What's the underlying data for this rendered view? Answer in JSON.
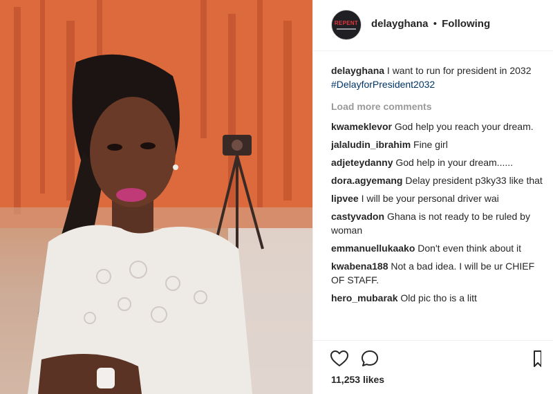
{
  "post": {
    "username": "delayghana",
    "separator": "•",
    "follow_status": "Following",
    "avatar_text": "REPENT",
    "caption": {
      "username": "delayghana",
      "text_before": "I want to run for president in 2032",
      "hashtag": "#DelayforPresident2032"
    },
    "load_more_label": "Load more comments",
    "comments": [
      {
        "user": "kwameklevor",
        "text": "God help you reach your dream."
      },
      {
        "user": "jalaludin_ibrahim",
        "text": "Fine girl"
      },
      {
        "user": "adjeteydanny",
        "text": "God help in your dream......"
      },
      {
        "user": "dora.agyemang",
        "text": "Delay president p3ky33 like that"
      },
      {
        "user": "lipvee",
        "text": "I will be your personal driver wai"
      },
      {
        "user": "castyvadon",
        "text": "Ghana is not ready to be ruled by woman"
      },
      {
        "user": "emmanuellukaako",
        "text": "Don't even think about it"
      },
      {
        "user": "kwabena188",
        "text": "Not a bad idea. I will be ur CHIEF OF STAFF."
      },
      {
        "user": "hero_mubarak",
        "text": "Old pic tho is a litt"
      }
    ],
    "likes": "11,253 likes"
  },
  "icons": {
    "like": "heart-icon",
    "comment": "speech-bubble-icon",
    "save": "bookmark-icon"
  },
  "colors": {
    "hashtag": "#003569",
    "muted": "#999999",
    "text": "#262626"
  }
}
